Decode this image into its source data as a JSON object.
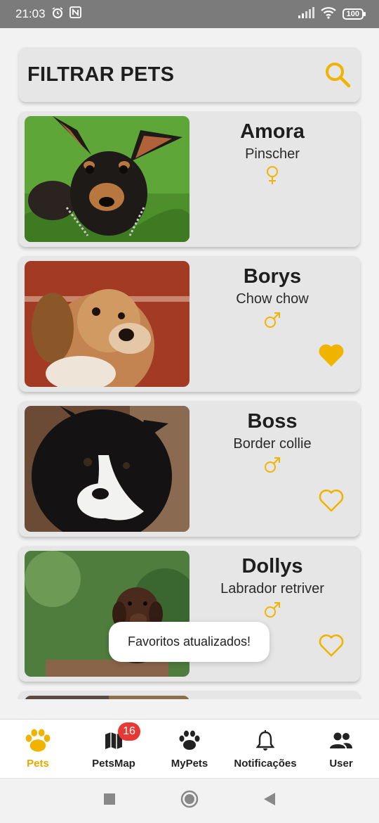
{
  "status_bar": {
    "time": "21:03",
    "battery": "100"
  },
  "header": {
    "title": "FILTRAR PETS"
  },
  "pets": [
    {
      "name": "Amora",
      "breed": "Pinscher",
      "gender": "female",
      "favorite": null
    },
    {
      "name": "Borys",
      "breed": "Chow chow",
      "gender": "male",
      "favorite": true
    },
    {
      "name": "Boss",
      "breed": "Border collie",
      "gender": "male",
      "favorite": false
    },
    {
      "name": "Dollys",
      "breed": "Labrador retriver",
      "gender": "male",
      "favorite": false
    }
  ],
  "toast": {
    "message": "Favoritos atualizados!"
  },
  "nav": {
    "items": [
      {
        "label": "Pets",
        "icon": "paw-icon",
        "active": true
      },
      {
        "label": "PetsMap",
        "icon": "map-icon",
        "badge": "16"
      },
      {
        "label": "MyPets",
        "icon": "paw-icon"
      },
      {
        "label": "Notificações",
        "icon": "bell-icon"
      },
      {
        "label": "User",
        "icon": "users-icon"
      }
    ]
  },
  "colors": {
    "accent": "#f0b400",
    "card": "#e6e6e6",
    "badge": "#e53935",
    "status_bar": "#7b7b7b"
  }
}
